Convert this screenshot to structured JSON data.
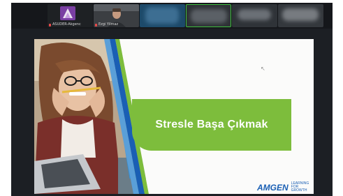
{
  "participants": [
    {
      "name": "ASUDER-Akgenc",
      "avatar": "logo"
    },
    {
      "name": "Ezgi Yilmaz",
      "avatar": "camera"
    },
    {
      "name": "",
      "avatar": "blurred"
    },
    {
      "name": "",
      "avatar": "blurred",
      "active_speaker": true
    },
    {
      "name": "",
      "avatar": "blurred"
    },
    {
      "name": "",
      "avatar": "blurred"
    }
  ],
  "slide": {
    "title": "Stresle Başa Çıkmak",
    "brand_main": "AMGEN",
    "brand_sub_line1": "LEARNING",
    "brand_sub_line2": "FOR GROWTH"
  },
  "colors": {
    "accent_green": "#7dbd3c",
    "accent_blue": "#1a5fb4",
    "window_bg": "#1c1f24"
  }
}
